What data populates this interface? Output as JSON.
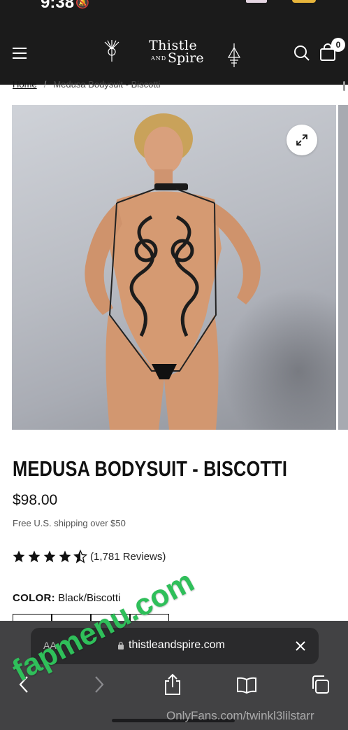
{
  "status_bar": {
    "time": "9:38"
  },
  "header": {
    "menu_icon": "hamburger-menu-icon",
    "logo_word_1": "Thistle",
    "logo_word_and": "AND",
    "logo_word_2": "Spire",
    "search_icon": "search-icon",
    "cart_icon": "shopping-bag-icon",
    "cart_count": "0"
  },
  "breadcrumb": {
    "home": "Home",
    "separator": "/",
    "current": "Medusa Bodysuit - Biscotti"
  },
  "gallery": {
    "zoom_icon": "expand-icon"
  },
  "product": {
    "title": "MEDUSA BODYSUIT - BISCOTTI",
    "price": "$98.00",
    "shipping_note": "Free U.S. shipping over $50",
    "rating": 4.5,
    "reviews_label": "(1,781 Reviews)",
    "color_label": "COLOR:",
    "color_value": "Black/Biscotti"
  },
  "browser": {
    "text_size_label": "AA",
    "url": "thistleandspire.com",
    "lock_icon": "lock-icon",
    "close_icon": "close-icon",
    "nav_icons": [
      "back-icon",
      "forward-icon",
      "share-icon",
      "bookmarks-icon",
      "tabs-icon"
    ]
  },
  "watermarks": {
    "overlay": "fapmenu.com",
    "footer": "OnlyFans.com/twinkl3lilstarr"
  },
  "colors": {
    "header_bg": "#1b1b1b",
    "toolbar_bg": "#3a3a3c",
    "watermark_green": "#2fbf5a",
    "star": "#111111"
  }
}
